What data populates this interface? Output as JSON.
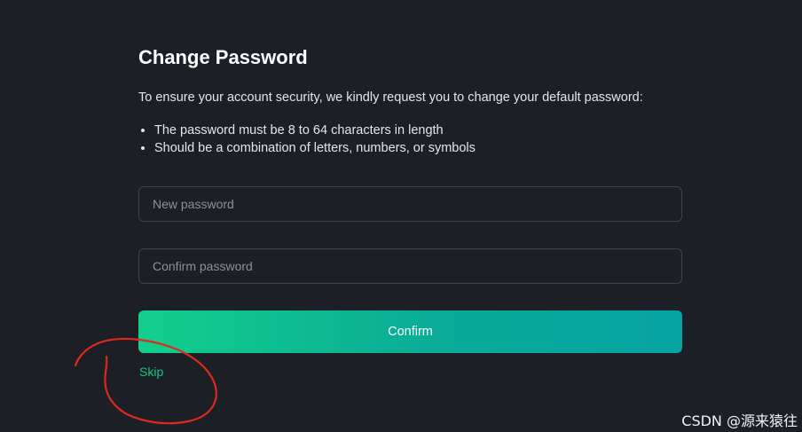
{
  "page": {
    "title": "Change Password",
    "intro": "To ensure your account security, we kindly request you to change your default password:",
    "rules": [
      "The password must be 8 to 64 characters in length",
      "Should be a combination of letters, numbers, or symbols"
    ]
  },
  "form": {
    "new_password": {
      "value": "",
      "placeholder": "New password"
    },
    "confirm_password": {
      "value": "",
      "placeholder": "Confirm password"
    },
    "confirm_label": "Confirm",
    "skip_label": "Skip"
  },
  "annotation": {
    "mark": "red hand-drawn circle around Skip",
    "color": "#e0281e"
  },
  "watermark": "CSDN @源来猿往",
  "colors": {
    "background": "#1c1f26",
    "accent_start": "#12cf8c",
    "accent_end": "#07a2a3",
    "skip_link": "#17c784",
    "field_border": "#3e4350"
  }
}
